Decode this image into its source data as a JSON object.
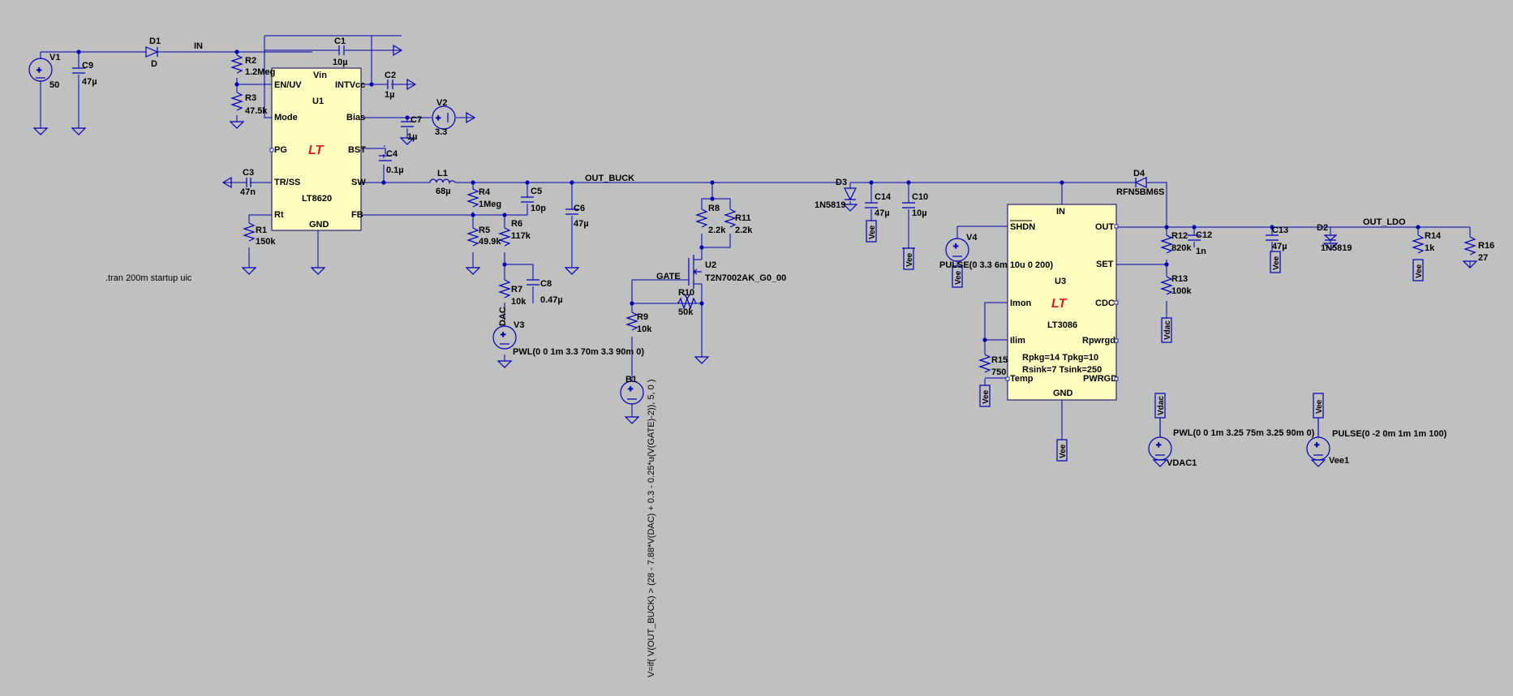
{
  "colors": {
    "background": "#c0c0c0",
    "wire": "#0000b0",
    "ic_fill": "#ffffc0",
    "logo": "#e02020"
  },
  "nets": {
    "in": "IN",
    "out_buck": "OUT_BUCK",
    "gate": "GATE",
    "out_ldo": "OUT_LDO",
    "dac": "DAC",
    "vee": "Vee",
    "vdac": "Vdac"
  },
  "directive": ".tran 200m startup uic",
  "u1": {
    "ref": "U1",
    "part": "LT8620",
    "pins": {
      "vin": "Vin",
      "en": "EN/UV",
      "intvcc": "INTVcc",
      "mode": "Mode",
      "bias": "Bias",
      "pg": "PG",
      "bst": "BST",
      "trss": "TR/SS",
      "sw": "SW",
      "rt": "Rt",
      "fb": "FB",
      "gnd": "GND"
    }
  },
  "u3": {
    "ref": "U3",
    "part": "LT3086",
    "pins": {
      "in": "IN",
      "shdn": "SHDN",
      "out": "OUT",
      "set": "SET",
      "imon": "Imon",
      "cdc": "CDC",
      "ilim": "Ilim",
      "rpwrgd": "Rpwrgd",
      "temp": "Temp",
      "pwrgd": "PWRGD",
      "gnd": "GND"
    },
    "params1": "Rpkg=14 Tpkg=10",
    "params2": "Rsink=7 Tsink=250"
  },
  "u2": {
    "ref": "U2",
    "part": "T2N7002AK_G0_00"
  },
  "sources": {
    "v1": {
      "ref": "V1",
      "value": "50"
    },
    "v2": {
      "ref": "V2",
      "value": "3.3"
    },
    "v3": {
      "ref": "V3",
      "value": "PWL(0 0 1m 3.3 70m 3.3 90m 0)"
    },
    "v4": {
      "ref": "V4",
      "value": "PULSE(0 3.3 6m 10u 0 200)",
      "overlap": "3.3"
    },
    "b1": {
      "ref": "B1",
      "value": "V=if( V(OUT_BUCK) > (28 - 7.88*V(DAC) + 0.3 - 0.25*u(V(GATE)-2)), 5, 0 )"
    },
    "vdac1": {
      "ref": "VDAC1",
      "value": "PWL(0 0 1m 3.25 75m 3.25 90m 0)"
    },
    "vee1": {
      "ref": "Vee1",
      "value": "PULSE(0 -2 0m 1m 1m 100)"
    }
  },
  "resistors": {
    "r1": {
      "ref": "R1",
      "value": "150k"
    },
    "r2": {
      "ref": "R2",
      "value": "1.2Meg"
    },
    "r3": {
      "ref": "R3",
      "value": "47.5k"
    },
    "r4": {
      "ref": "R4",
      "value": "1Meg"
    },
    "r5": {
      "ref": "R5",
      "value": "49.9k"
    },
    "r6": {
      "ref": "R6",
      "value": "117k"
    },
    "r7": {
      "ref": "R7",
      "value": "10k"
    },
    "r8": {
      "ref": "R8",
      "value": "2.2k"
    },
    "r9": {
      "ref": "R9",
      "value": "10k"
    },
    "r10": {
      "ref": "R10",
      "value": "50k"
    },
    "r11": {
      "ref": "R11",
      "value": "2.2k"
    },
    "r12": {
      "ref": "R12",
      "value": "820k"
    },
    "r13": {
      "ref": "R13",
      "value": "100k"
    },
    "r14": {
      "ref": "R14",
      "value": "1k"
    },
    "r15": {
      "ref": "R15",
      "value": "750"
    },
    "r16": {
      "ref": "R16",
      "value": "27"
    }
  },
  "capacitors": {
    "c1": {
      "ref": "C1",
      "value": "10µ"
    },
    "c2": {
      "ref": "C2",
      "value": "1µ"
    },
    "c3": {
      "ref": "C3",
      "value": "47n"
    },
    "c4": {
      "ref": "C4",
      "value": "0.1µ"
    },
    "c5": {
      "ref": "C5",
      "value": "10p"
    },
    "c6": {
      "ref": "C6",
      "value": "47µ"
    },
    "c7": {
      "ref": "C7",
      "value": "1µ"
    },
    "c8": {
      "ref": "C8",
      "value": "0.47µ"
    },
    "c9": {
      "ref": "C9",
      "value": "47µ"
    },
    "c10": {
      "ref": "C10",
      "value": "10µ"
    },
    "c12": {
      "ref": "C12",
      "value": "1n"
    },
    "c13": {
      "ref": "C13",
      "value": "47µ"
    },
    "c14": {
      "ref": "C14",
      "value": "47µ"
    }
  },
  "inductors": {
    "l1": {
      "ref": "L1",
      "value": "68µ"
    }
  },
  "diodes": {
    "d1": {
      "ref": "D1",
      "value": "D"
    },
    "d2": {
      "ref": "D2",
      "value": "1N5819"
    },
    "d3": {
      "ref": "D3",
      "value": "1N5819"
    },
    "d4": {
      "ref": "D4",
      "value": "RFN5BM6S"
    }
  }
}
